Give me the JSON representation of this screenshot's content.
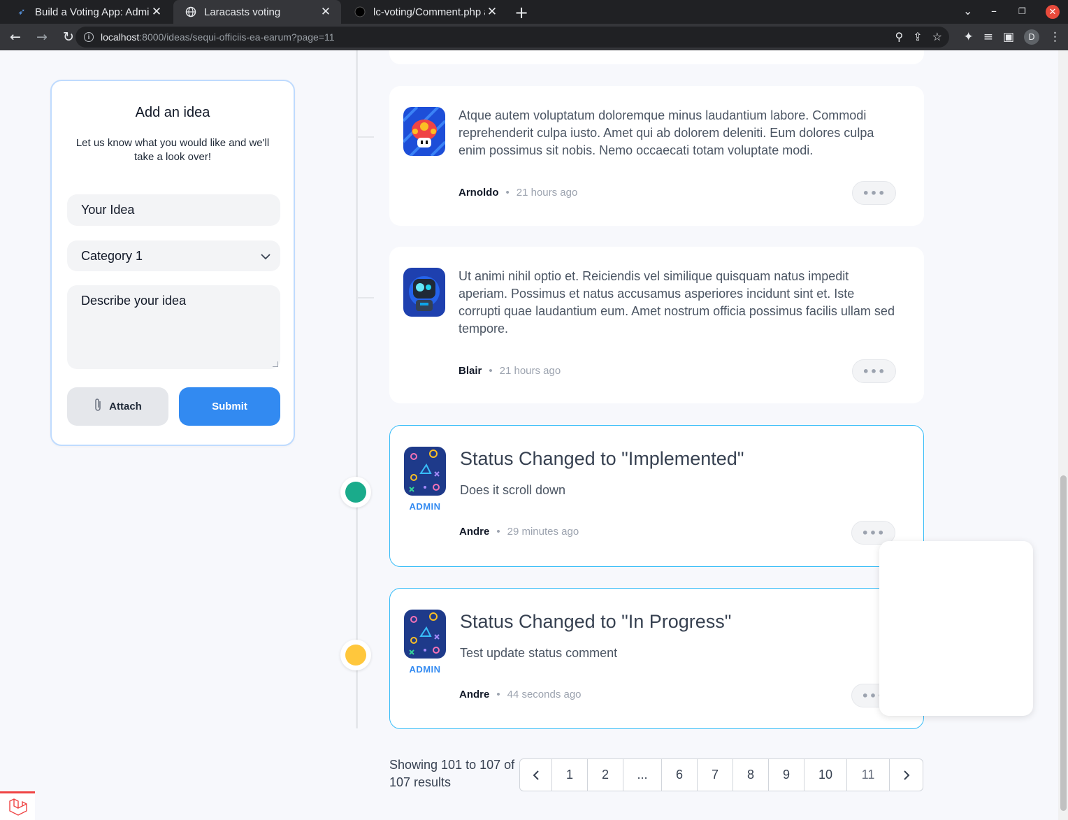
{
  "browser": {
    "tabs": [
      {
        "title": "Build a Voting App: Admi",
        "active": false,
        "icon": "laracasts-icon"
      },
      {
        "title": "Laracasts voting",
        "active": true,
        "icon": "globe-icon"
      },
      {
        "title": "lc-voting/Comment.php a",
        "active": false,
        "icon": "github-icon"
      }
    ],
    "url_host": "localhost",
    "url_rest": ":8000/ideas/sequi-officiis-ea-earum?page=11",
    "profile_initial": "D"
  },
  "sidebar": {
    "title": "Add an idea",
    "subtitle": "Let us know what you would like and we'll take a look over!",
    "idea_placeholder": "Your Idea",
    "category_value": "Category 1",
    "description_placeholder": "Describe your idea",
    "attach_label": "Attach",
    "submit_label": "Submit"
  },
  "comments": [
    {
      "body": "Atque autem voluptatum doloremque minus laudantium labore. Commodi reprehenderit culpa iusto. Amet qui ab dolorem deleniti. Eum dolores culpa enim possimus sit nobis. Nemo occaecati totam voluptate modi.",
      "author": "Arnoldo",
      "time": "21 hours ago",
      "avatar": "mushroom-avatar"
    },
    {
      "body": "Ut animi nihil optio et. Reiciendis vel similique quisquam natus impedit aperiam. Possimus et natus accusamus asperiores incidunt sint et. Iste corrupti quae laudantium eum. Amet nostrum officia possimus facilis ullam sed tempore.",
      "author": "Blair",
      "time": "21 hours ago",
      "avatar": "robot-avatar"
    },
    {
      "title": "Status Changed to \"Implemented\"",
      "body": "Does it scroll down",
      "author": "Andre",
      "time": "29 minutes ago",
      "badge": "ADMIN",
      "status_color": "#1aab8b"
    },
    {
      "title": "Status Changed to \"In Progress\"",
      "body": "Test update status comment",
      "author": "Andre",
      "time": "44 seconds ago",
      "badge": "ADMIN",
      "status_color": "#ffc73c"
    }
  ],
  "more_label": "•••",
  "separator": "•",
  "pagination": {
    "showing": "Showing 101 to 107 of 107 results",
    "pages": [
      "1",
      "2",
      "...",
      "6",
      "7",
      "8",
      "9",
      "10",
      "11"
    ],
    "current": "11"
  },
  "colors": {
    "accent_blue": "#328af1",
    "status_border": "#38bdf8"
  }
}
